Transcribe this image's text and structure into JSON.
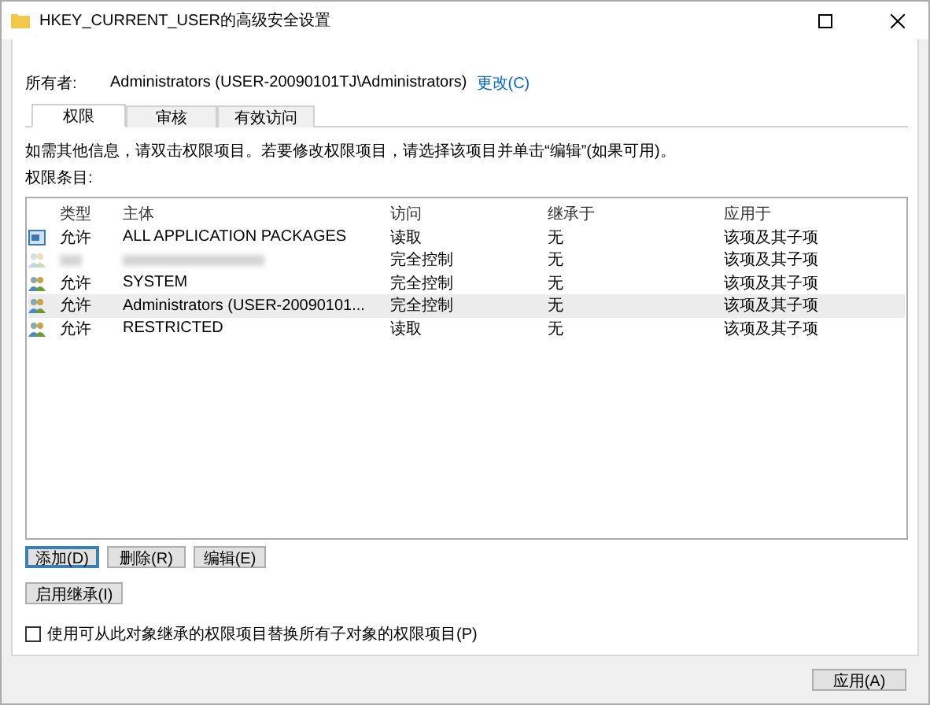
{
  "window": {
    "title": "HKEY_CURRENT_USER的高级安全设置"
  },
  "owner": {
    "label": "所有者:",
    "value": "Administrators (USER-20090101TJ\\Administrators)",
    "link": "更改(C)"
  },
  "tabs": [
    {
      "label": "权限",
      "selected": true
    },
    {
      "label": "审核",
      "selected": false
    },
    {
      "label": "有效访问",
      "selected": false
    }
  ],
  "info": "如需其他信息，请双击权限项目。若要修改权限项目，请选择该项目并单击“编辑”(如果可用)。",
  "list_label": "权限条目:",
  "table": {
    "columns": [
      "类型",
      "主体",
      "访问",
      "继承于",
      "应用于"
    ],
    "rows": [
      {
        "kind": "package",
        "redacted": false,
        "selected": false,
        "cells": [
          "允许",
          "ALL APPLICATION PACKAGES",
          "读取",
          "无",
          "该项及其子项"
        ]
      },
      {
        "kind": "group",
        "redacted": true,
        "selected": false,
        "cells": [
          "",
          "",
          "完全控制",
          "无",
          "该项及其子项"
        ]
      },
      {
        "kind": "group",
        "redacted": false,
        "selected": false,
        "cells": [
          "允许",
          "SYSTEM",
          "完全控制",
          "无",
          "该项及其子项"
        ]
      },
      {
        "kind": "group",
        "redacted": false,
        "selected": true,
        "cells": [
          "允许",
          "Administrators (USER-20090101...",
          "完全控制",
          "无",
          "该项及其子项"
        ]
      },
      {
        "kind": "group",
        "redacted": false,
        "selected": false,
        "cells": [
          "允许",
          "RESTRICTED",
          "读取",
          "无",
          "该项及其子项"
        ]
      }
    ]
  },
  "buttons": [
    {
      "label": "添加(D)",
      "focused": true
    },
    {
      "label": "删除(R)",
      "focused": false
    },
    {
      "label": "编辑(E)",
      "focused": false
    }
  ],
  "inherit_button": "启用继承(I)",
  "replace_checkbox": {
    "label": "使用可从此对象继承的权限项目替换所有子对象的权限项目(P)",
    "checked": false
  },
  "footer_buttons": [
    "应用(A)"
  ]
}
